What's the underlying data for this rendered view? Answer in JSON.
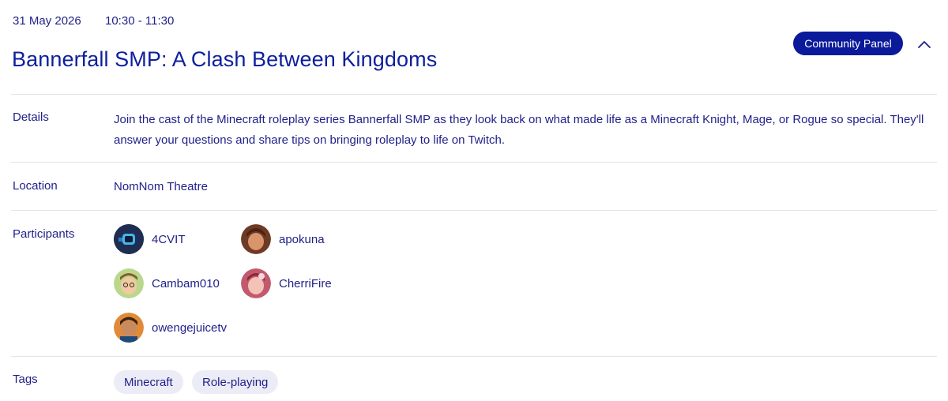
{
  "event": {
    "date": "31 May 2026",
    "time": "10:30 - 11:30",
    "title": "Bannerfall SMP: A Clash Between Kingdoms",
    "badge": "Community Panel"
  },
  "details": {
    "label": "Details",
    "text": "Join the cast of the Minecraft roleplay series Bannerfall SMP as they look back on what made life as a Minecraft Knight, Mage, or Rogue so special. They'll answer your questions and share tips on bringing roleplay to life on Twitch."
  },
  "location": {
    "label": "Location",
    "value": "NomNom Theatre"
  },
  "participants": {
    "label": "Participants",
    "items": [
      {
        "name": "4CVIT"
      },
      {
        "name": "apokuna"
      },
      {
        "name": "Cambam010"
      },
      {
        "name": "CherriFire"
      },
      {
        "name": "owengejuicetv"
      }
    ]
  },
  "tags": {
    "label": "Tags",
    "items": [
      {
        "name": "Minecraft"
      },
      {
        "name": "Role-playing"
      }
    ]
  },
  "icons": {
    "collapse": "chevron-up-icon"
  },
  "colors": {
    "primary": "#0a1a9a",
    "text": "#1f1f8a",
    "tag_bg": "#ececf7",
    "divider": "#e3e3ec"
  }
}
